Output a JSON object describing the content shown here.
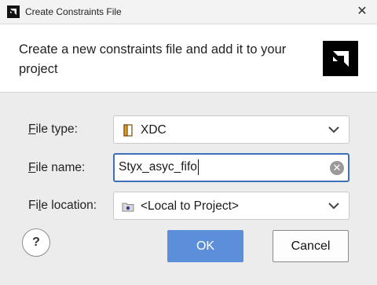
{
  "window": {
    "title": "Create Constraints File",
    "close_glyph": "✕"
  },
  "header": {
    "description": "Create a new constraints file and add it to your project"
  },
  "form": {
    "file_type": {
      "label_mnemonic": "F",
      "label_rest": "ile type:",
      "value": "XDC",
      "icon": "xdc-file-icon"
    },
    "file_name": {
      "label_mnemonic": "F",
      "label_rest": "ile name:",
      "value": "Styx_asyc_fifo",
      "clear_glyph": "✕"
    },
    "file_location": {
      "label_before": "Fi",
      "label_mnemonic": "l",
      "label_rest": "e location:",
      "value": "<Local to Project>",
      "icon": "folder-icon"
    }
  },
  "buttons": {
    "help": "?",
    "ok": "OK",
    "cancel": "Cancel"
  },
  "colors": {
    "accent": "#3f6fb6",
    "ok_button": "#5b8fd9"
  }
}
